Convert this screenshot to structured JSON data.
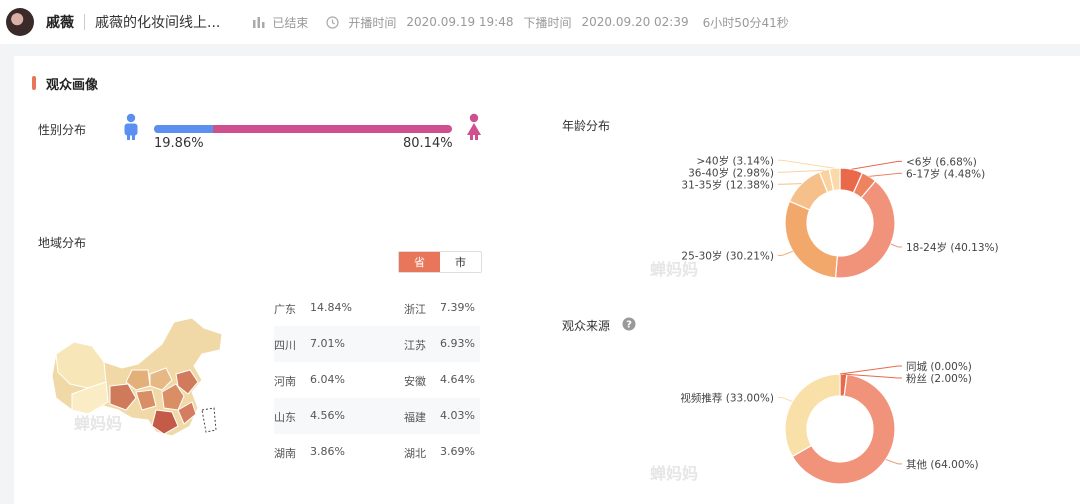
{
  "header": {
    "name": "戚薇",
    "title": "戚薇的化妆间线上...",
    "status": "已结束",
    "start_label": "开播时间",
    "start_time": "2020.09.19 19:48",
    "end_label": "下播时间",
    "end_time": "2020.09.20 02:39",
    "duration": "6小时50分41秒"
  },
  "section_title": "观众画像",
  "gender": {
    "title": "性别分布",
    "male_pct": "19.86%",
    "female_pct": "80.14%",
    "male_value": 19.86,
    "colors": {
      "male": "#5b8ff0",
      "female": "#d04f8e"
    }
  },
  "region": {
    "title": "地域分布",
    "tabs": [
      "省",
      "市"
    ],
    "rows": [
      [
        {
          "name": "广东",
          "value": "14.84%"
        },
        {
          "name": "浙江",
          "value": "7.39%"
        }
      ],
      [
        {
          "name": "四川",
          "value": "7.01%"
        },
        {
          "name": "江苏",
          "value": "6.93%"
        }
      ],
      [
        {
          "name": "河南",
          "value": "6.04%"
        },
        {
          "name": "安徽",
          "value": "4.64%"
        }
      ],
      [
        {
          "name": "山东",
          "value": "4.56%"
        },
        {
          "name": "福建",
          "value": "4.03%"
        }
      ],
      [
        {
          "name": "湖南",
          "value": "3.86%"
        },
        {
          "name": "湖北",
          "value": "3.69%"
        }
      ]
    ]
  },
  "watermark": "蝉妈妈",
  "chart_data": [
    {
      "type": "pie",
      "title": "年龄分布",
      "series": [
        {
          "name": "<6岁",
          "value": 6.68,
          "label": "<6岁 (6.68%)",
          "color": "#e9694a"
        },
        {
          "name": "6-17岁",
          "value": 4.48,
          "label": "6-17岁 (4.48%)",
          "color": "#ee8360"
        },
        {
          "name": "18-24岁",
          "value": 40.13,
          "label": "18-24岁 (40.13%)",
          "color": "#f0937a"
        },
        {
          "name": "25-30岁",
          "value": 30.21,
          "label": "25-30岁 (30.21%)",
          "color": "#f2a86a"
        },
        {
          "name": "31-35岁",
          "value": 12.38,
          "label": "31-35岁 (12.38%)",
          "color": "#f6c08a"
        },
        {
          "name": "36-40岁",
          "value": 2.98,
          "label": "36-40岁 (2.98%)",
          "color": "#f9d2a0"
        },
        {
          "name": ">40岁",
          "value": 3.14,
          "label": ">40岁 (3.14%)",
          "color": "#fbd9a8"
        }
      ]
    },
    {
      "type": "pie",
      "title": "观众来源",
      "series": [
        {
          "name": "同城",
          "value": 0.0,
          "label": "同城 (0.00%)",
          "color": "#e9694a"
        },
        {
          "name": "粉丝",
          "value": 2.0,
          "label": "粉丝 (2.00%)",
          "color": "#e9694a"
        },
        {
          "name": "其他",
          "value": 64.0,
          "label": "其他 (64.00%)",
          "color": "#f0937a"
        },
        {
          "name": "视频推荐",
          "value": 33.0,
          "label": "视频推荐 (33.00%)",
          "color": "#f9e0a8"
        }
      ]
    }
  ]
}
